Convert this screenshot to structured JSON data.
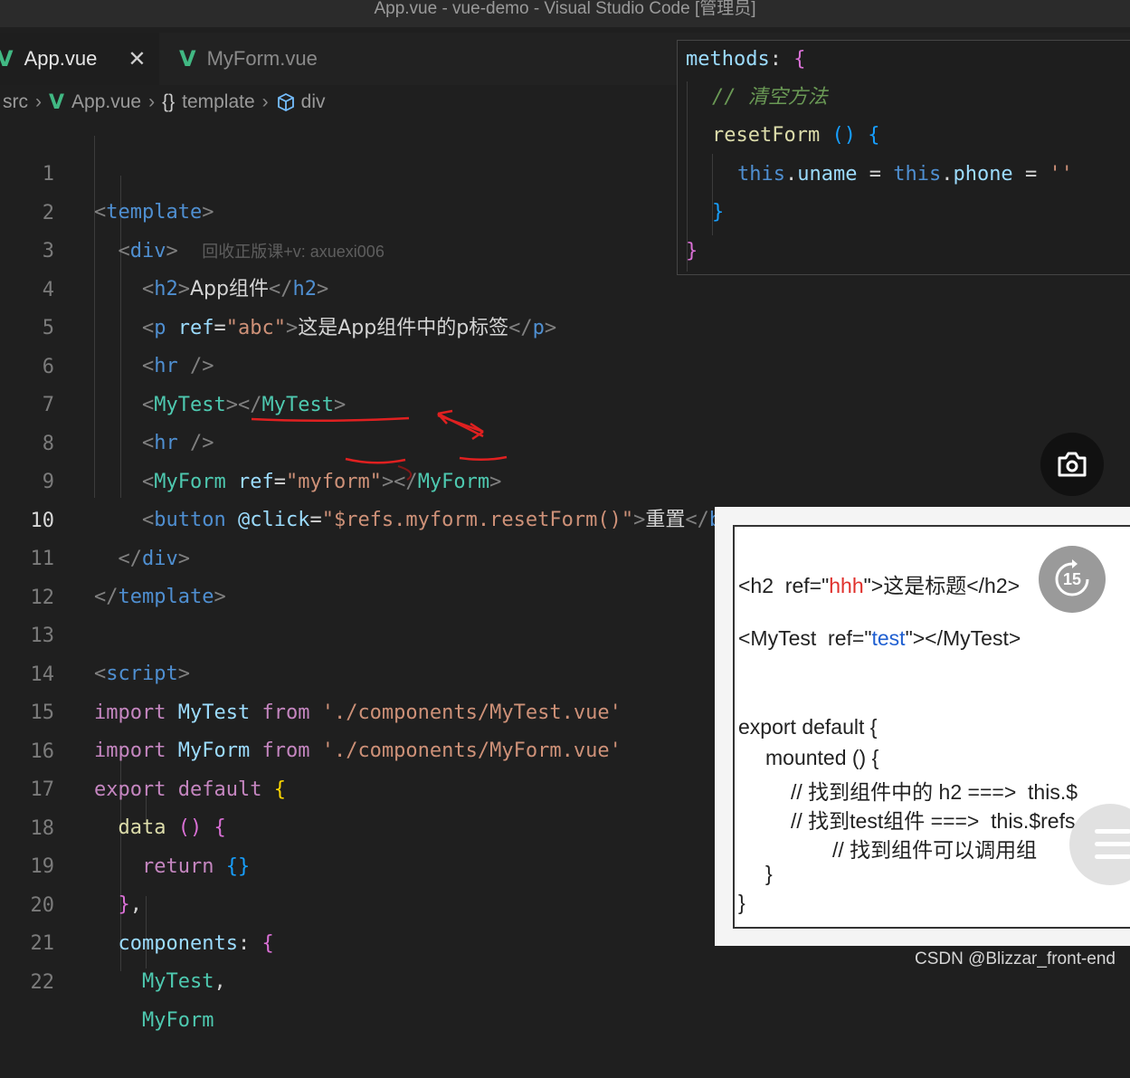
{
  "window": {
    "title": "App.vue - vue-demo - Visual Studio Code [管理员]"
  },
  "tabs": [
    {
      "label": "App.vue",
      "icon": "V",
      "active": true,
      "close": "✕"
    },
    {
      "label": "MyForm.vue",
      "icon": "V",
      "active": false
    }
  ],
  "breadcrumb": {
    "folder": "src",
    "file": "App.vue",
    "braces": "{}",
    "template": "template",
    "div": "div"
  },
  "code": {
    "ln": [
      "1",
      "2",
      "3",
      "4",
      "5",
      "6",
      "7",
      "8",
      "9",
      "10",
      "11",
      "12",
      "13",
      "14",
      "15",
      "16",
      "17",
      "18",
      "19",
      "20",
      "21",
      "22"
    ],
    "l2_watermark": "回收正版课+v: axuexi006",
    "l3_text": "App组件",
    "l4_ref": "\"abc\"",
    "l4_text": "这是App组件中的p标签",
    "l8_ref": "\"myform\"",
    "l9_click": "\"$refs.myform.resetForm()\"",
    "l9_text": "重置",
    "l14_path": "'./components/MyTest.vue'",
    "l15_path": "'./components/MyForm.vue'"
  },
  "popup": {
    "methods": "methods",
    "comment": "// 清空方法",
    "fn": "resetForm",
    "assign": "''"
  },
  "slide": {
    "line1_a": "<h2  ref=\"",
    "line1_ref": "hhh",
    "line1_b": "\">这是标题</h2>",
    "line2_a": "<MyTest  ref=\"",
    "line2_ref": "test",
    "line2_b": "\"></MyTest>",
    "line3": "export default {",
    "line4": "mounted () {",
    "line5": "// 找到组件中的 h2 ===>  this.$",
    "line6": "// 找到test组件 ===>  this.$refs",
    "line7": "// 找到组件可以调用组",
    "line8": "}",
    "line9": "}"
  },
  "overlay": {
    "replay_label": "15"
  },
  "footer": {
    "csdn": "CSDN @Blizzar_front-end"
  },
  "colors": {
    "vue_green": "#41b883",
    "keyword": "#c586c0",
    "tag": "#4f8fd1",
    "string": "#ce9178",
    "component": "#4ec9b0",
    "annotation_red": "#e02020"
  }
}
